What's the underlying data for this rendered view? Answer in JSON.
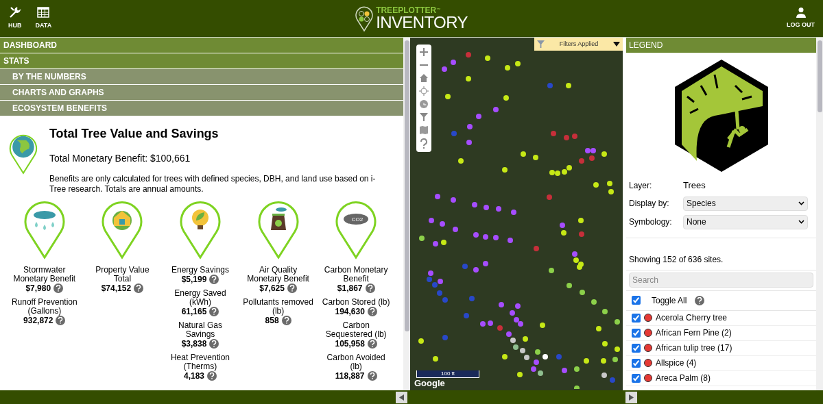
{
  "header": {
    "left_buttons": [
      {
        "kind": "hub",
        "label": "HUB"
      },
      {
        "kind": "data",
        "label": "DATA"
      }
    ],
    "logo": {
      "top": "TREEPLOTTER",
      "tm": "™",
      "bottom": "INVENTORY"
    },
    "right_button": {
      "label": "LOG OUT"
    }
  },
  "nav": [
    {
      "label": "DASHBOARD"
    },
    {
      "label": "STATS",
      "children": [
        {
          "label": "BY THE NUMBERS"
        },
        {
          "label": "CHARTS AND GRAPHS"
        },
        {
          "label": "ECOSYSTEM BENEFITS"
        }
      ]
    }
  ],
  "summary": {
    "title": "Total Tree Value and Savings",
    "total": "Total Monetary Benefit: $100,661",
    "note": "Benefits are only calculated for trees with defined species, DBH, and land use based on i-Tree research. Totals are annual amounts."
  },
  "benefits": [
    {
      "kind": "stormwater",
      "metrics": [
        {
          "label": "Stormwater Monetary Benefit",
          "value": "$7,980"
        },
        {
          "label": "Runoff Prevention (Gallons)",
          "value": "932,872"
        }
      ]
    },
    {
      "kind": "property",
      "metrics": [
        {
          "label": "Property Value Total",
          "value": "$74,152"
        }
      ]
    },
    {
      "kind": "energy",
      "metrics": [
        {
          "label": "Energy Savings",
          "value": "$5,199"
        },
        {
          "label": "Energy Saved (kWh)",
          "value": "61,165"
        },
        {
          "label": "Natural Gas Savings",
          "value": "$3,838"
        },
        {
          "label": "Heat Prevention (Therms)",
          "value": "4,183"
        }
      ]
    },
    {
      "kind": "air",
      "metrics": [
        {
          "label": "Air Quality Monetary Benefit",
          "value": "$7,625"
        },
        {
          "label": "Pollutants removed (lb)",
          "value": "858"
        }
      ]
    },
    {
      "kind": "carbon",
      "icon_text": "CO2",
      "metrics": [
        {
          "label": "Carbon Monetary Benefit",
          "value": "$1,867"
        },
        {
          "label": "Carbon Stored (lb)",
          "value": "194,630"
        },
        {
          "label": "Carbon Sequestered (lb)",
          "value": "105,958"
        },
        {
          "label": "Carbon Avoided (lb)",
          "value": "118,887"
        }
      ]
    }
  ],
  "map": {
    "filter_label": "Filters Applied",
    "scale": "100 ft",
    "attribution": "Google"
  },
  "legend": {
    "title": "LEGEND",
    "layer_label": "Layer:",
    "layer_value": "Trees",
    "display_label": "Display by:",
    "display_value": "Species",
    "symbology_label": "Symbology:",
    "symbology_value": "None",
    "showing": "Showing 152 of 636 sites.",
    "search_placeholder": "Search",
    "toggle_all": {
      "label": "Toggle All",
      "checked": true
    },
    "species": [
      {
        "label": "Acerola Cherry tree",
        "checked": true,
        "color": "#e53935"
      },
      {
        "label": "African Fern Pine (2)",
        "checked": true,
        "color": "#e53935"
      },
      {
        "label": "African tulip tree (17)",
        "checked": true,
        "color": "#e53935"
      },
      {
        "label": "Allspice (4)",
        "checked": true,
        "color": "#e53935"
      },
      {
        "label": "Areca Palm (8)",
        "checked": true,
        "color": "#e53935"
      }
    ]
  }
}
